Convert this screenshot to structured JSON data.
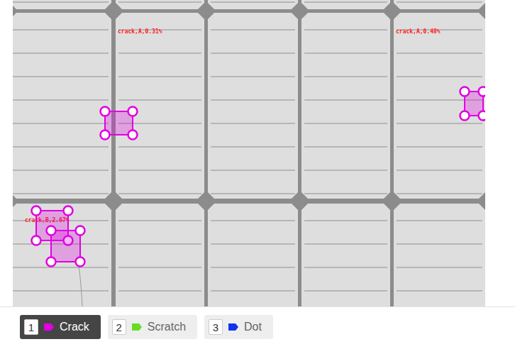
{
  "image": {
    "labels": [
      {
        "text": "crack,A,0.31%",
        "color": "#ff2020"
      },
      {
        "text": "crack,A,0.48%",
        "color": "#ff2020"
      },
      {
        "text": "crack,B,2.67%",
        "color": "#ff2020"
      }
    ],
    "annotations": [
      {
        "label": "Crack",
        "color": "#e100e1"
      },
      {
        "label": "Crack",
        "color": "#e100e1"
      },
      {
        "label": "Crack",
        "color": "#e100e1"
      },
      {
        "label": "Crack",
        "color": "#e100e1"
      }
    ]
  },
  "tools": [
    {
      "key": "1",
      "label": "Crack",
      "color": "#e100e1",
      "selected": true
    },
    {
      "key": "2",
      "label": "Scratch",
      "color": "#66dd22",
      "selected": false
    },
    {
      "key": "3",
      "label": "Dot",
      "color": "#1133ee",
      "selected": false
    }
  ]
}
